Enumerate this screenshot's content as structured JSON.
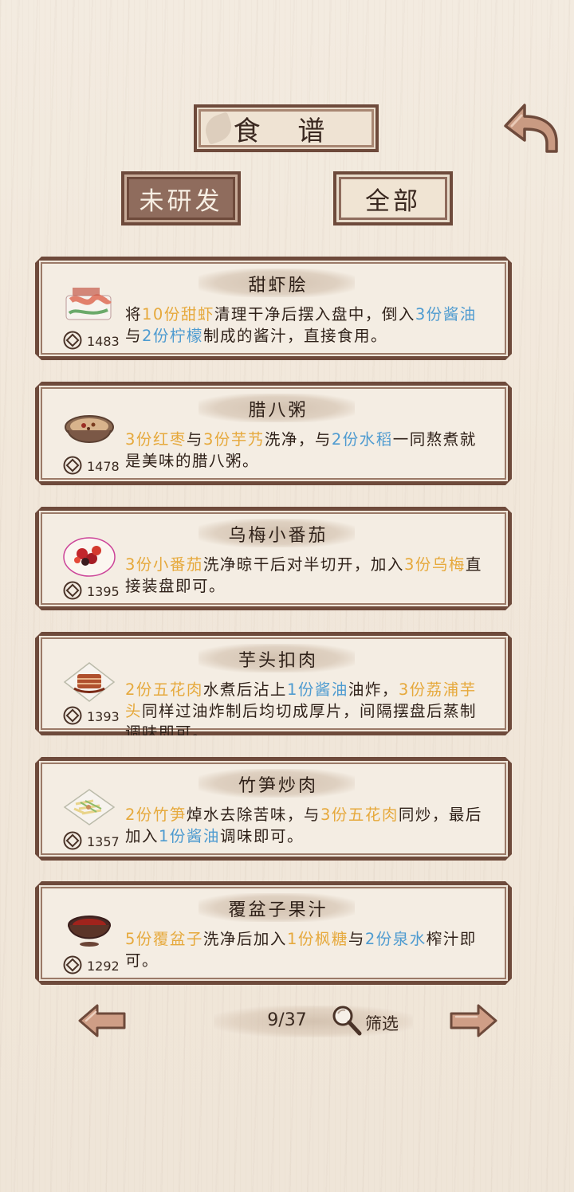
{
  "header": {
    "title": "食 谱",
    "back_icon": "back-arrow-icon",
    "tabs": [
      {
        "label": "未研发",
        "active": true
      },
      {
        "label": "全部",
        "active": false
      }
    ]
  },
  "recipes": [
    {
      "name": "甜虾脍",
      "icon": "sweet-shrimp-dish-icon",
      "price": "1483",
      "segments": [
        {
          "t": "将",
          "c": ""
        },
        {
          "t": "10份甜虾",
          "c": "y"
        },
        {
          "t": "清理干净后摆入盘中，倒入",
          "c": ""
        },
        {
          "t": "3份酱油",
          "c": "b"
        },
        {
          "t": "与",
          "c": ""
        },
        {
          "t": "2份柠檬",
          "c": "b"
        },
        {
          "t": "制成的酱汁，直接食用。",
          "c": ""
        }
      ]
    },
    {
      "name": "腊八粥",
      "icon": "laba-porridge-icon",
      "price": "1478",
      "segments": [
        {
          "t": "3份红枣",
          "c": "y"
        },
        {
          "t": "与",
          "c": ""
        },
        {
          "t": "3份芋艿",
          "c": "y"
        },
        {
          "t": "洗净，与",
          "c": ""
        },
        {
          "t": "2份水稻",
          "c": "b"
        },
        {
          "t": "一同熬煮就是美味的腊八粥。",
          "c": ""
        }
      ]
    },
    {
      "name": "乌梅小番茄",
      "icon": "plum-tomato-dish-icon",
      "price": "1395",
      "segments": [
        {
          "t": "3份小番茄",
          "c": "y"
        },
        {
          "t": "洗净晾干后对半切开，加入",
          "c": ""
        },
        {
          "t": "3份乌梅",
          "c": "y"
        },
        {
          "t": "直接装盘即可。",
          "c": ""
        }
      ]
    },
    {
      "name": "芋头扣肉",
      "icon": "taro-pork-dish-icon",
      "price": "1393",
      "segments": [
        {
          "t": "2份五花肉",
          "c": "y"
        },
        {
          "t": "水煮后沾上",
          "c": ""
        },
        {
          "t": "1份酱油",
          "c": "b"
        },
        {
          "t": "油炸，",
          "c": ""
        },
        {
          "t": "3份荔浦芋头",
          "c": "y"
        },
        {
          "t": "同样过油炸制后均切成厚片，间隔摆盘后蒸制调味即可。",
          "c": ""
        }
      ]
    },
    {
      "name": "竹笋炒肉",
      "icon": "bamboo-shoot-pork-icon",
      "price": "1357",
      "segments": [
        {
          "t": "2份竹笋",
          "c": "y"
        },
        {
          "t": "焯水去除苦味，与",
          "c": ""
        },
        {
          "t": "3份五花肉",
          "c": "y"
        },
        {
          "t": "同炒，最后加入",
          "c": ""
        },
        {
          "t": "1份酱油",
          "c": "b"
        },
        {
          "t": "调味即可。",
          "c": ""
        }
      ]
    },
    {
      "name": "覆盆子果汁",
      "icon": "raspberry-juice-icon",
      "price": "1292",
      "segments": [
        {
          "t": "5份覆盆子",
          "c": "y"
        },
        {
          "t": "洗净后加入",
          "c": ""
        },
        {
          "t": "1份枫糖",
          "c": "y"
        },
        {
          "t": "与",
          "c": ""
        },
        {
          "t": "2份泉水",
          "c": "b"
        },
        {
          "t": "榨汁即可。",
          "c": ""
        }
      ]
    }
  ],
  "pager": {
    "page": "9/37",
    "filter_label": "筛选",
    "filter_icon": "magnifier-icon",
    "prev_icon": "prev-arrow-icon",
    "next_icon": "next-arrow-icon"
  },
  "colors": {
    "frame_brown": "#6e4a3b",
    "highlight_yellow": "#e6a93c",
    "highlight_blue": "#4e9bd0",
    "paper": "#f3ebe0"
  }
}
